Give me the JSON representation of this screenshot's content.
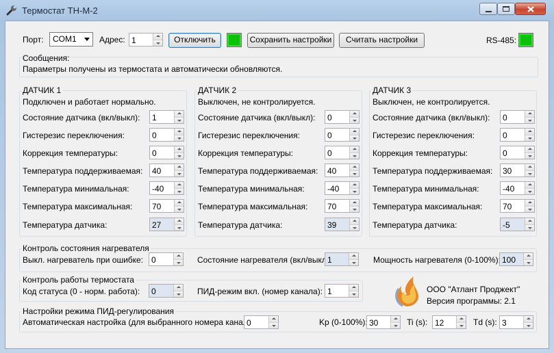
{
  "window": {
    "title": "Термостат ТН-М-2"
  },
  "toolbar": {
    "port_label": "Порт:",
    "port_value": "COM1",
    "address_label": "Адрес:",
    "address_value": "1",
    "disconnect_label": "Отключить",
    "save_label": "Сохранить настройки",
    "read_label": "Считать настройки",
    "rs485_label": "RS-485:",
    "led_color": "#09c209"
  },
  "messages": {
    "title": "Сообщения:",
    "text": "Параметры получены из термостата и автоматически обновляются."
  },
  "sensor_labels": {
    "state": "Состояние датчика (вкл/выкл):",
    "hysteresis": "Гистерезис переключения:",
    "correction": "Коррекция температуры:",
    "target": "Температура поддерживаемая:",
    "min": "Температура минимальная:",
    "max": "Температура максимальная:",
    "current": "Температура датчика:"
  },
  "sensors": [
    {
      "title": "ДАТЧИК 1",
      "status": "Подключен и работает нормально.",
      "state": "1",
      "hysteresis": "0",
      "correction": "0",
      "target": "40",
      "min": "-40",
      "max": "70",
      "current": "27"
    },
    {
      "title": "ДАТЧИК 2",
      "status": "Выключен, не контролируется.",
      "state": "0",
      "hysteresis": "0",
      "correction": "0",
      "target": "40",
      "min": "-40",
      "max": "70",
      "current": "39"
    },
    {
      "title": "ДАТЧИК 3",
      "status": "Выключен, не контролируется.",
      "state": "0",
      "hysteresis": "0",
      "correction": "0",
      "target": "30",
      "min": "-40",
      "max": "70",
      "current": "-5"
    }
  ],
  "heater": {
    "title": "Контроль состояния нагревателя",
    "off_on_error_label": "Выкл. нагреватель при ошибке:",
    "off_on_error_value": "0",
    "state_label": "Состояние нагревателя (вкл/выкл):",
    "state_value": "1",
    "power_label": "Мощность нагревателя (0-100%):",
    "power_value": "100"
  },
  "thermostat": {
    "title": "Контроль работы термостата",
    "status_label": "Код статуса (0 - норм. работа):",
    "status_value": "0",
    "pid_label": "ПИД-режим вкл. (номер канала):",
    "pid_value": "1"
  },
  "company": {
    "name": "ООО \"Атлант Проджект\"",
    "version": "Версия программы: 2.1",
    "logo_icon": "flame-logo"
  },
  "pid": {
    "title": "Настройки режима ПИД-регулирования",
    "auto_label": "Автоматическая настройка (для выбранного номера канала):",
    "auto_value": "0",
    "kp_label": "Kp (0-100%):",
    "kp_value": "30",
    "ti_label": "Ti (s):",
    "ti_value": "12",
    "td_label": "Td (s):",
    "td_value": "3"
  }
}
